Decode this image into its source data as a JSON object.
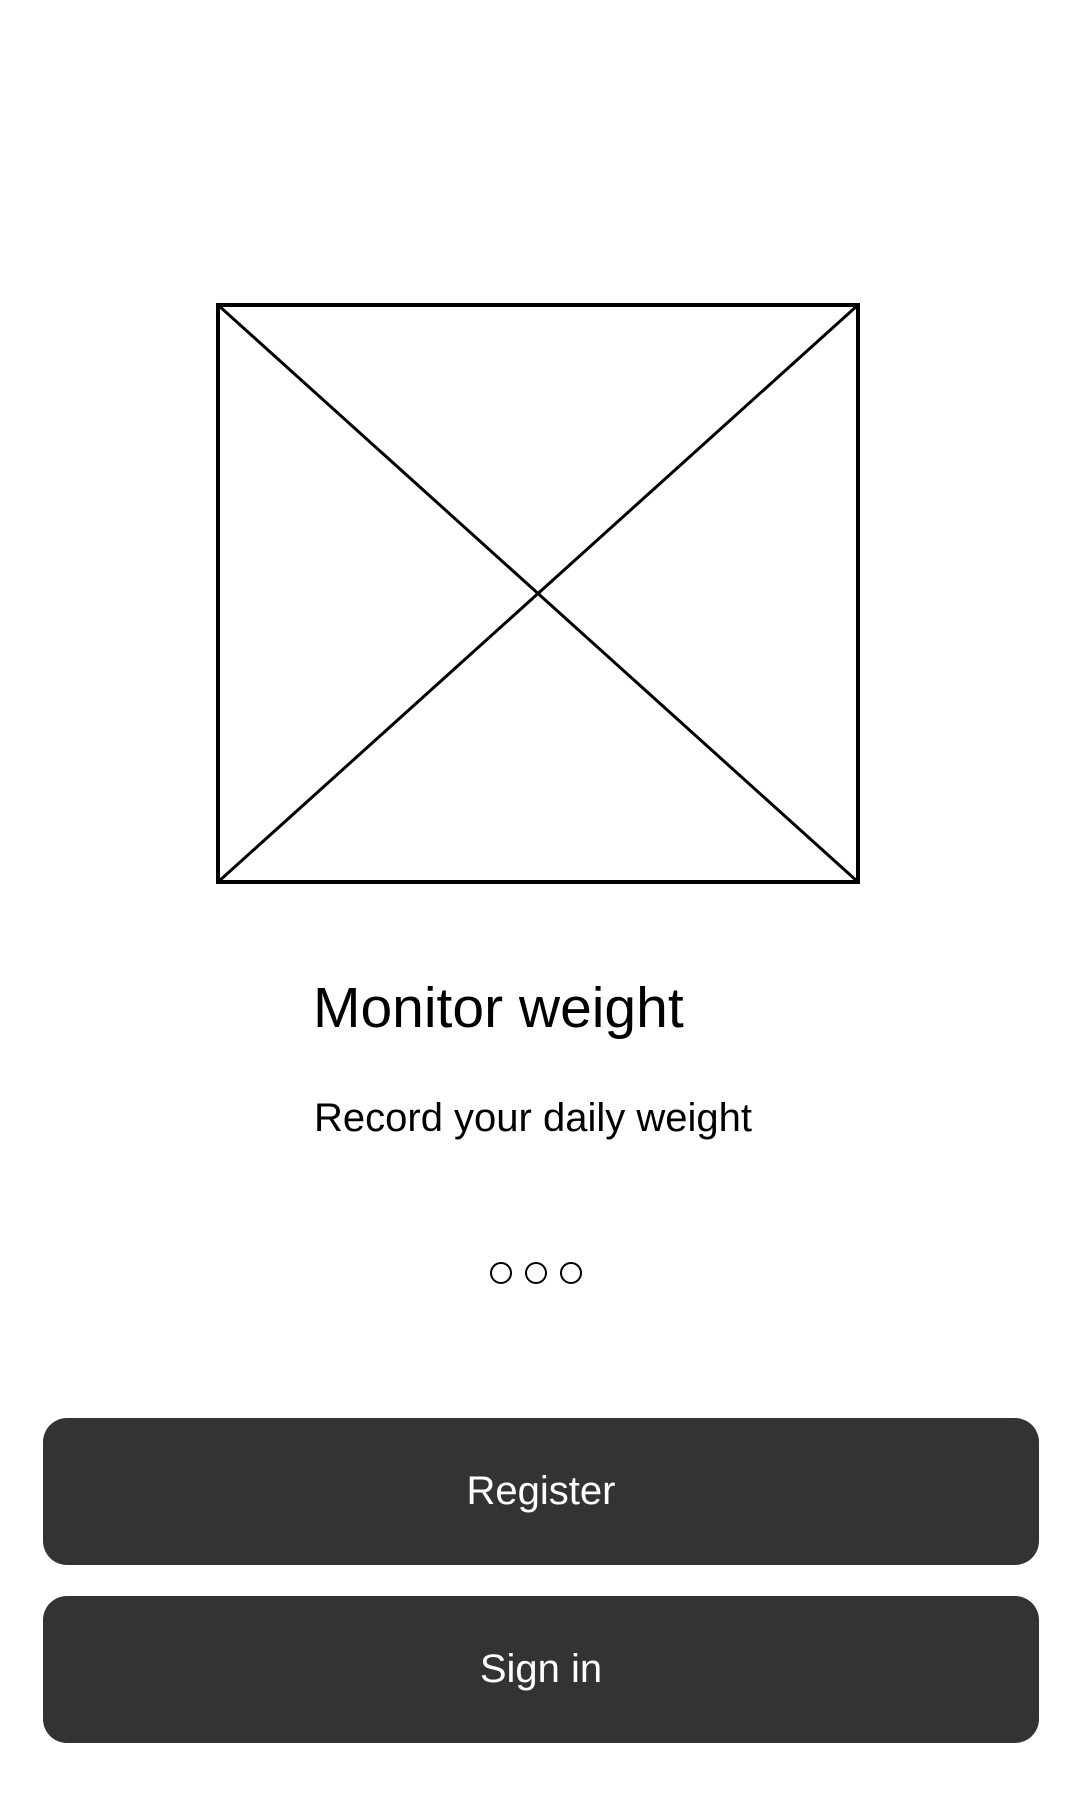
{
  "hero": {
    "image_icon": "image-placeholder-icon"
  },
  "onboarding": {
    "title": "Monitor weight",
    "subtitle": "Record your daily weight",
    "page_indicator": {
      "total_pages": 3
    }
  },
  "actions": {
    "register_label": "Register",
    "sign_in_label": "Sign in"
  },
  "colors": {
    "button_background": "#333333",
    "button_text": "#ffffff",
    "background": "#ffffff",
    "line": "#000000"
  }
}
